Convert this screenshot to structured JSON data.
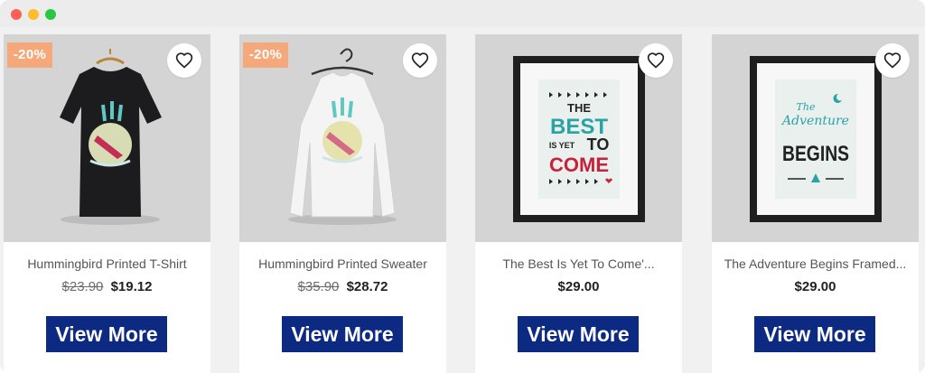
{
  "window": {
    "controls": [
      "close",
      "minimize",
      "zoom"
    ]
  },
  "colors": {
    "discount_badge": "#f5a97a",
    "button": "#0d2a82",
    "image_background": "#d4d4d4"
  },
  "products": [
    {
      "name": "Hummingbird Printed T-Shirt",
      "discount": "-20%",
      "old_price": "$23.90",
      "price": "$19.12",
      "button_label": "View More",
      "image_icon": "black-tshirt-image"
    },
    {
      "name": "Hummingbird Printed Sweater",
      "discount": "-20%",
      "old_price": "$35.90",
      "price": "$28.72",
      "button_label": "View More",
      "image_icon": "white-sweater-image"
    },
    {
      "name": "The Best Is Yet To Come'...",
      "price": "$29.00",
      "button_label": "View More",
      "image_icon": "framed-poster-image",
      "poster_text": [
        "THE",
        "BEST",
        "IS YET",
        "TO",
        "COME"
      ]
    },
    {
      "name": "The Adventure Begins Framed...",
      "price": "$29.00",
      "button_label": "View More",
      "image_icon": "framed-poster-image",
      "poster_text": [
        "The",
        "Adventure",
        "BEGINS"
      ]
    }
  ]
}
